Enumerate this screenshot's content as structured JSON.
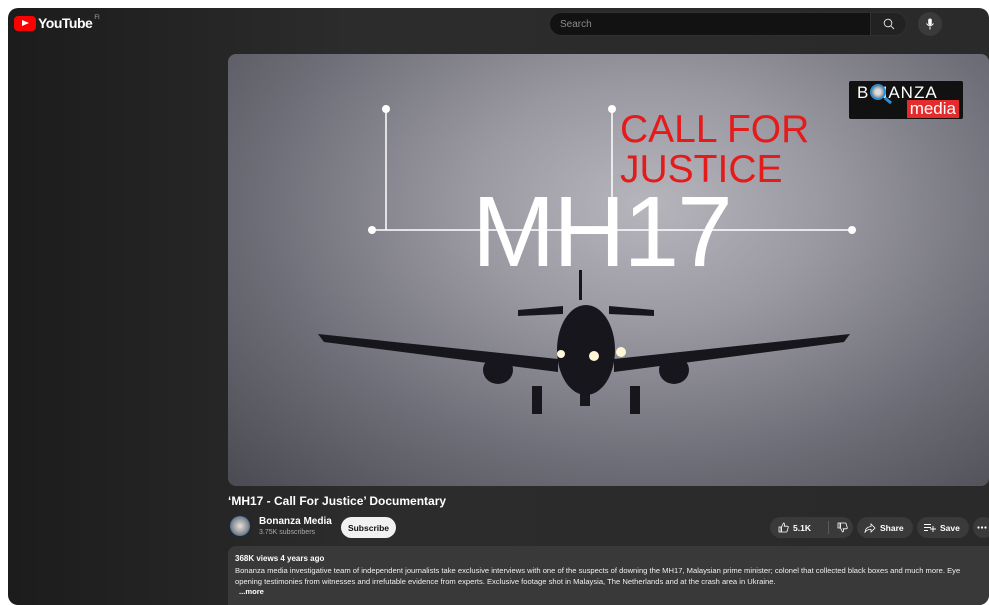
{
  "header": {
    "logo_text": "YouTube",
    "region_code": "FI",
    "search_placeholder": "Search"
  },
  "video": {
    "title_overlay_main": "MH17",
    "title_overlay_red_line1": "CALL FOR",
    "title_overlay_red_line2": "JUSTICE",
    "brand_line1": "B NANZA",
    "brand_line2": "media"
  },
  "details": {
    "title": "‘MH17 - Call For Justice’ Documentary",
    "channel_name": "Bonanza Media",
    "subscribers": "3.75K subscribers",
    "subscribe_label": "Subscribe",
    "like_count": "5.1K",
    "share_label": "Share",
    "save_label": "Save"
  },
  "description": {
    "meta": "368K views  4 years ago",
    "text": "Bonanza media investigative team of independent journalists take exclusive interviews with one of the suspects of downing the MH17, Malaysian prime minister; colonel that collected black boxes and much more. Eye opening testimonies from witnesses and irrefutable evidence from experts. Exclusive footage shot in Malaysia, The Netherlands and at the crash area in Ukraine.",
    "more_label": "...more"
  },
  "colors": {
    "youtube_red": "#ff0000",
    "overlay_red": "#e31b1b",
    "background": "#2a2a2a"
  },
  "icons": [
    "youtube-logo-icon",
    "search-icon",
    "mic-icon",
    "thumb-up-icon",
    "thumb-down-icon",
    "share-icon",
    "save-playlist-icon",
    "more-icon"
  ]
}
